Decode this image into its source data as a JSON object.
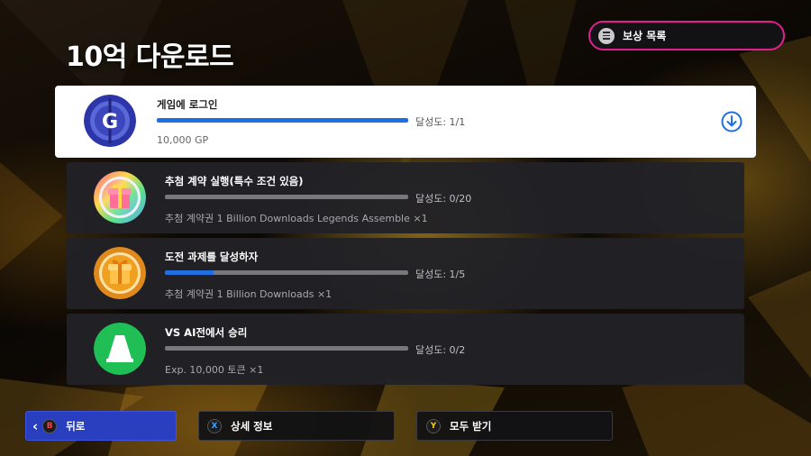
{
  "page": {
    "title": "10억 다운로드"
  },
  "reward_list": {
    "label": "보상 목록",
    "icon": "menu-icon",
    "accent": "#e02090"
  },
  "missions": [
    {
      "title": "게임에 로그인",
      "progress_text": "달성도: 1/1",
      "progress": 1.0,
      "reward": "10,000 GP",
      "icon": "coin-g-icon",
      "selected": true
    },
    {
      "title": "추첨 계약 실행(특수 조건 있음)",
      "progress_text": "달성도: 0/20",
      "progress": 0.0,
      "reward": "추첨 계약권 1 Billion Downloads Legends Assemble ×1",
      "icon": "rainbow-gift-icon"
    },
    {
      "title": "도전 과제를 달성하자",
      "progress_text": "달성도: 1/5",
      "progress": 0.2,
      "reward": "추첨 계약권 1 Billion Downloads ×1",
      "icon": "orange-gift-icon"
    },
    {
      "title": "VS AI전에서 승리",
      "progress_text": "달성도: 0/2",
      "progress": 0.0,
      "reward": "Exp. 10,000 토큰 ×1",
      "icon": "green-cone-icon"
    }
  ],
  "footer": {
    "back": {
      "key": "B",
      "label": "뒤로"
    },
    "details": {
      "key": "X",
      "label": "상세 정보"
    },
    "claim_all": {
      "key": "Y",
      "label": "모두 받기"
    }
  },
  "colors": {
    "progress_fill": "#1f6fe0",
    "back_button": "#2a3fbf"
  }
}
